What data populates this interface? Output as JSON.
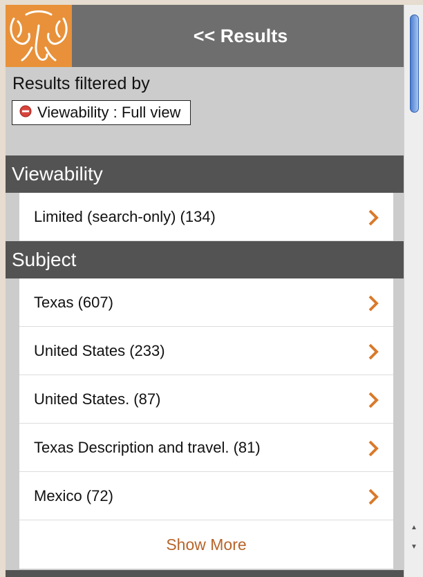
{
  "header": {
    "back_label": "<< Results"
  },
  "filters": {
    "heading": "Results filtered by",
    "active": [
      {
        "label": "Viewability : Full view"
      }
    ]
  },
  "sections": [
    {
      "title": "Viewability",
      "items": [
        {
          "label": "Limited (search-only) (134)"
        }
      ]
    },
    {
      "title": "Subject",
      "items": [
        {
          "label": "Texas (607)"
        },
        {
          "label": "United States (233)"
        },
        {
          "label": "United States. (87)"
        },
        {
          "label": "Texas Description and travel. (81)"
        },
        {
          "label": "Mexico (72)"
        }
      ],
      "show_more_label": "Show More"
    }
  ],
  "colors": {
    "accent": "#e8913a",
    "chevron": "#d97a2b",
    "section_header": "#535353",
    "header": "#6e6e6e",
    "link": "#b7642a",
    "remove_icon": "#d8443c"
  },
  "icons": {
    "logo": "elephant-logo-icon",
    "remove": "remove-filter-icon",
    "chevron": "chevron-right-icon"
  }
}
